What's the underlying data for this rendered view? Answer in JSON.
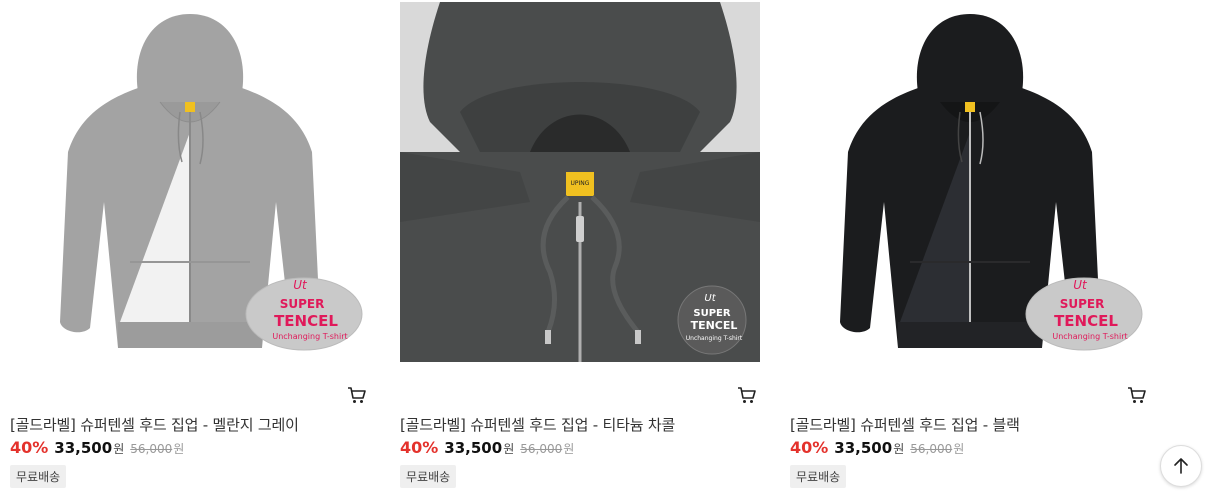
{
  "products": [
    {
      "title": "[골드라벨] 슈퍼텐셀 후드 집업 - 멜란지 그레이",
      "discount": "40%",
      "price": "33,500",
      "currency": "원",
      "original_price": "56,000",
      "original_currency": "원",
      "badge": "무료배송",
      "image": {
        "garment_color": "#a3a3a3",
        "bg_color": "#ffffff",
        "label_text": "UPING"
      },
      "swatch": {
        "line1": "Ut",
        "line2": "SUPER",
        "line3": "TENCEL",
        "line4": "Unchanging T-shirt"
      }
    },
    {
      "title": "[골드라벨] 슈퍼텐셀 후드 집업 - 티타늄 차콜",
      "discount": "40%",
      "price": "33,500",
      "currency": "원",
      "original_price": "56,000",
      "original_currency": "원",
      "badge": "무료배송",
      "image": {
        "garment_color": "#4a4c4c",
        "bg_color": "#d9d9d9",
        "label_text": "UPING"
      },
      "swatch": {
        "line1": "Ut",
        "line2": "SUPER",
        "line3": "TENCEL",
        "line4": "Unchanging T-shirt"
      }
    },
    {
      "title": "[골드라벨] 슈퍼텐셀 후드 집업 - 블랙",
      "discount": "40%",
      "price": "33,500",
      "currency": "원",
      "original_price": "56,000",
      "original_currency": "원",
      "badge": "무료배송",
      "image": {
        "garment_color": "#1b1c1e",
        "bg_color": "#ffffff",
        "label_text": "UPING"
      },
      "swatch": {
        "line1": "Ut",
        "line2": "SUPER",
        "line3": "TENCEL",
        "line4": "Unchanging T-shirt"
      }
    }
  ],
  "icons": {
    "cart": "cart-icon",
    "scroll_top": "arrow-up-icon"
  },
  "colors": {
    "discount": "#e4322c",
    "swatch_text": "#e0195a"
  }
}
